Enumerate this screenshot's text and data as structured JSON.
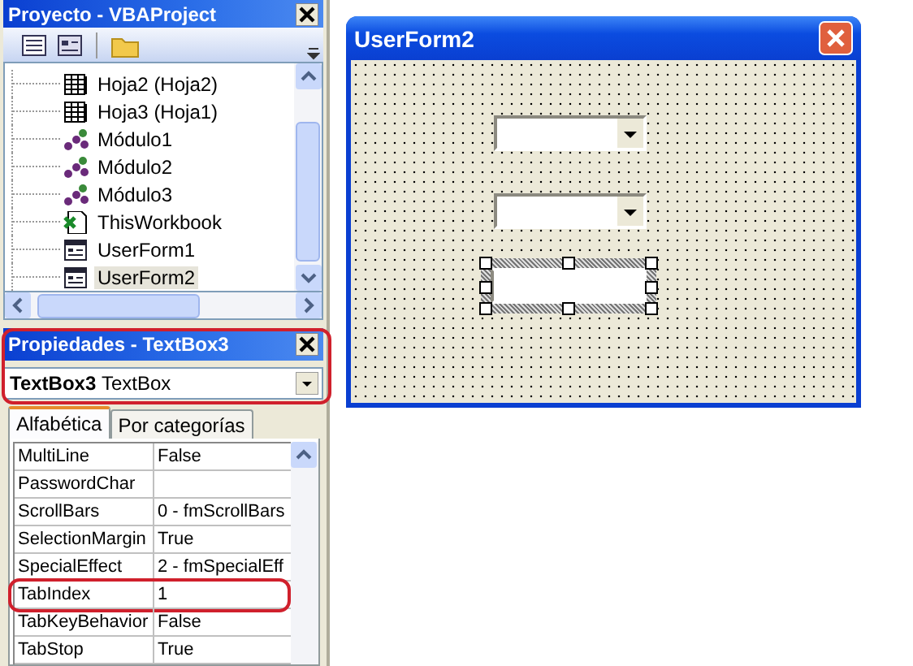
{
  "project_panel": {
    "title": "Proyecto - VBAProject",
    "tree": [
      {
        "label": "Hoja2 (Hoja2)",
        "kind": "sheet",
        "selected": false
      },
      {
        "label": "Hoja3 (Hoja1)",
        "kind": "sheet",
        "selected": false
      },
      {
        "label": "Módulo1",
        "kind": "module",
        "selected": false
      },
      {
        "label": "Módulo2",
        "kind": "module",
        "selected": false
      },
      {
        "label": "Módulo3",
        "kind": "module",
        "selected": false
      },
      {
        "label": "ThisWorkbook",
        "kind": "workbook",
        "selected": false
      },
      {
        "label": "UserForm1",
        "kind": "form",
        "selected": false
      },
      {
        "label": "UserForm2",
        "kind": "form",
        "selected": true
      }
    ]
  },
  "properties_panel": {
    "title": "Propiedades - TextBox3",
    "highlighted": true,
    "object": {
      "name": "TextBox3",
      "type": "TextBox"
    },
    "tabs": [
      {
        "label": "Alfabética",
        "selected": true
      },
      {
        "label": "Por categorías",
        "selected": false
      }
    ],
    "rows": [
      {
        "name": "MultiLine",
        "value": "False",
        "highlighted": false
      },
      {
        "name": "PasswordChar",
        "value": "",
        "highlighted": false
      },
      {
        "name": "ScrollBars",
        "value": "0 - fmScrollBars",
        "highlighted": false
      },
      {
        "name": "SelectionMargin",
        "value": "True",
        "highlighted": false
      },
      {
        "name": "SpecialEffect",
        "value": "2 - fmSpecialEff",
        "highlighted": false
      },
      {
        "name": "TabIndex",
        "value": "1",
        "highlighted": true
      },
      {
        "name": "TabKeyBehavior",
        "value": "False",
        "highlighted": false
      },
      {
        "name": "TabStop",
        "value": "True",
        "highlighted": false
      }
    ]
  },
  "form": {
    "title": "UserForm2",
    "controls": [
      {
        "kind": "combobox",
        "selected": false
      },
      {
        "kind": "combobox",
        "selected": false
      },
      {
        "kind": "textbox",
        "selected": true
      }
    ]
  }
}
